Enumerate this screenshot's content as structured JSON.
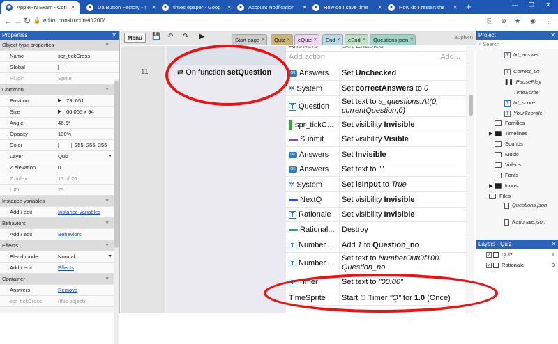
{
  "browser": {
    "tabs": [
      {
        "title": "AppleRN Exam - Con",
        "active": true
      },
      {
        "title": "Da Button Factory - !",
        "active": false
      },
      {
        "title": "times epaper - Goog",
        "active": false
      },
      {
        "title": "Account Notification",
        "active": false
      },
      {
        "title": "How do I save time",
        "active": false
      },
      {
        "title": "How do I restart the",
        "active": false
      }
    ],
    "url": "editor.construct.net/r200/"
  },
  "properties": {
    "header": "Properties",
    "rows": [
      {
        "type": "section",
        "label": "Object type properties"
      },
      {
        "type": "row",
        "key": "Name",
        "value": "spr_tickCross"
      },
      {
        "type": "row",
        "key": "Global",
        "value": "",
        "check": true
      },
      {
        "type": "row",
        "key": "Plugin",
        "value": "Sprite",
        "dim": true
      },
      {
        "type": "section",
        "label": "Common"
      },
      {
        "type": "row",
        "key": "Position",
        "value": "79, 651",
        "arrow": true
      },
      {
        "type": "row",
        "key": "Size",
        "value": "66.055 x 94",
        "arrow": true
      },
      {
        "type": "row",
        "key": "Angle",
        "value": "46.6°"
      },
      {
        "type": "row",
        "key": "Opacity",
        "value": "100%"
      },
      {
        "type": "row",
        "key": "Color",
        "value": "255, 255, 255",
        "swatch": true
      },
      {
        "type": "row",
        "key": "Layer",
        "value": "Quiz",
        "dropdown": true
      },
      {
        "type": "row",
        "key": "Z elevation",
        "value": "0"
      },
      {
        "type": "row",
        "key": "Z index",
        "value": "17 of 26",
        "dim": true
      },
      {
        "type": "row",
        "key": "UID",
        "value": "23",
        "dim": true
      },
      {
        "type": "section",
        "label": "Instance variables"
      },
      {
        "type": "row",
        "key": "Add / edit",
        "value": "Instance variables",
        "link": true
      },
      {
        "type": "section",
        "label": "Behaviors"
      },
      {
        "type": "row",
        "key": "Add / edit",
        "value": "Behaviors",
        "link": true
      },
      {
        "type": "section",
        "label": "Effects"
      },
      {
        "type": "row",
        "key": "Blend mode",
        "value": "Normal",
        "dropdown": true
      },
      {
        "type": "row",
        "key": "Add / edit",
        "value": "Effects",
        "link": true
      },
      {
        "type": "section",
        "label": "Container"
      },
      {
        "type": "row",
        "key": "Answers",
        "value": "Remove",
        "link": true
      },
      {
        "type": "row",
        "key": "spr_tickCross",
        "value": "(this object)",
        "dim": true
      }
    ]
  },
  "toolbar": {
    "menu": "Menu",
    "layout_tabs": [
      "Start page",
      "Quiz",
      "eQuiz",
      "End",
      "eEnd",
      "Questions.json"
    ],
    "user": "applern"
  },
  "sheet": {
    "event_number": "11",
    "condition_prefix": "On function",
    "condition_name": "setQuestion",
    "faded_top": {
      "obj": "Answers",
      "act": "Set Enabled"
    },
    "add_action": "Add action",
    "add_action_right": "Add...",
    "actions": [
      {
        "icon": "button",
        "obj": "Answers",
        "act_html": "Set <b>Unchecked</b>"
      },
      {
        "icon": "gear",
        "obj": "System",
        "act_html": "Set <b>correctAnswers</b> to <i>0</i>"
      },
      {
        "icon": "text",
        "obj": "Question",
        "act_html": "Set text to <i>a_questions.At(0, currentQuestion,0)</i>"
      },
      {
        "icon": "sprite",
        "obj": "spr_tickC...",
        "act_html": "Set visibility <b>Invisible</b>"
      },
      {
        "icon": "bar-purple",
        "obj": "Submit",
        "act_html": "Set visibility <b>Visible</b>"
      },
      {
        "icon": "button",
        "obj": "Answers",
        "act_html": "Set <b>Invisible</b>"
      },
      {
        "icon": "button",
        "obj": "Answers",
        "act_html": "Set text to \"\""
      },
      {
        "icon": "gear",
        "obj": "System",
        "act_html": "Set <b>isInput</b> to <i>True</i>"
      },
      {
        "icon": "bar-blue",
        "obj": "NextQ",
        "act_html": "Set visibility <b>Invisible</b>"
      },
      {
        "icon": "text",
        "obj": "Rationale",
        "act_html": "Set visibility <b>Invisible</b>"
      },
      {
        "icon": "bar-green",
        "obj": "Rational...",
        "act_html": "Destroy"
      },
      {
        "icon": "text",
        "obj": "Number...",
        "act_html": "Add <i>1</i> to <b>Question_no</b>"
      },
      {
        "icon": "text",
        "obj": "Number...",
        "act_html": "Set text to <i>NumberOutOf100. Question_no</i>"
      },
      {
        "icon": "text",
        "obj": "Timer",
        "act_html": "Set text to <i>\"00:00\"</i>"
      },
      {
        "icon": "none",
        "obj": "TimeSprite",
        "act_html": "Start ⏱ Timer <i>\"Q\"</i> for <b>1.0</b> (Once)"
      }
    ]
  },
  "project": {
    "header": "Project",
    "search_placeholder": "Search",
    "items": [
      {
        "kind": "text",
        "label": "txt_answer",
        "italic": true
      },
      {
        "kind": "text",
        "label": "Correct_txt",
        "italic": true
      },
      {
        "kind": "pause",
        "label": "PausePlay",
        "italic": true
      },
      {
        "kind": "sprite",
        "label": "TimeSprite",
        "italic": true
      },
      {
        "kind": "text",
        "label": "txt_score",
        "italic": true
      },
      {
        "kind": "text",
        "label": "YourScoreIs",
        "italic": true
      },
      {
        "kind": "folder",
        "label": "Families"
      },
      {
        "kind": "folder-open",
        "label": "Timelines"
      },
      {
        "kind": "folder",
        "label": "Sounds"
      },
      {
        "kind": "folder",
        "label": "Music"
      },
      {
        "kind": "folder",
        "label": "Videos"
      },
      {
        "kind": "folder",
        "label": "Fonts"
      },
      {
        "kind": "folder-fill",
        "label": "Icons"
      },
      {
        "kind": "folder",
        "label": "Files"
      },
      {
        "kind": "doc",
        "label": "Questions.json",
        "italic": true
      },
      {
        "kind": "doc",
        "label": "Rationale.json",
        "italic": true
      }
    ]
  },
  "layers": {
    "header": "Layers - Quiz",
    "rows": [
      {
        "name": "Quiz",
        "num": "1"
      },
      {
        "name": "Rationale",
        "num": "0"
      }
    ]
  }
}
